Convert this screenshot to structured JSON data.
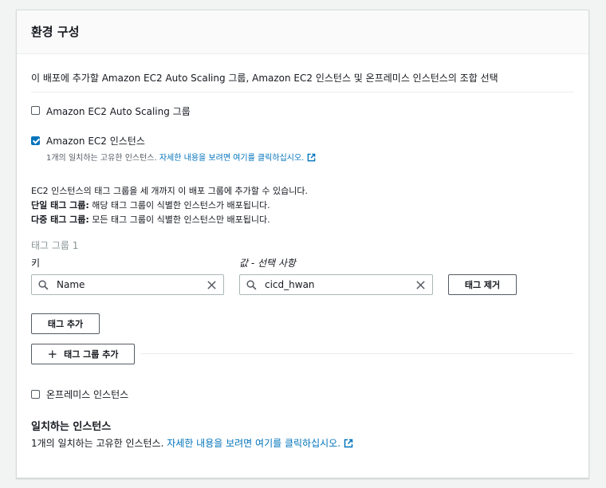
{
  "panel": {
    "title": "환경 구성",
    "description": "이 배포에 추가할 Amazon EC2 Auto Scaling 그룹, Amazon EC2 인스턴스 및 온프레미스 인스턴스의 조합 선택"
  },
  "options": {
    "asg": {
      "label": "Amazon EC2 Auto Scaling 그룹",
      "checked": false
    },
    "ec2": {
      "label": "Amazon EC2 인스턴스",
      "checked": true,
      "match_text": "1개의 일치하는 고유한 인스턴스. ",
      "match_link": "자세한 내용을 보려면 여기를 클릭하십시오."
    },
    "onprem": {
      "label": "온프레미스 인스턴스",
      "checked": false
    }
  },
  "info": {
    "line1": "EC2 인스턴스의 태그 그룹을 세 개까지 이 배포 그룹에 추가할 수 있습니다.",
    "single_bold": "단일 태그 그룹:",
    "single_text": " 해당 태그 그룹이 식별한 인스턴스가 배포됩니다.",
    "multi_bold": "다중 태그 그룹:",
    "multi_text": " 모든 태그 그룹이 식별한 인스턴스만 배포됩니다."
  },
  "tag_group": {
    "title": "태그 그룹 1",
    "key_label": "키",
    "value_label": "값 - 선택 사항",
    "key_value": "Name",
    "value_value": "cicd_hwan",
    "remove_label": "태그 제거",
    "add_tag_label": "태그 추가",
    "add_group_label": "태그 그룹 추가"
  },
  "matching": {
    "heading": "일치하는 인스턴스",
    "text": "1개의 일치하는 고유한 인스턴스. ",
    "link": "자세한 내용을 보려면 여기를 클릭하십시오."
  },
  "colors": {
    "accent": "#0073bb",
    "border": "#aab7b8",
    "header_bg": "#fafafa"
  }
}
